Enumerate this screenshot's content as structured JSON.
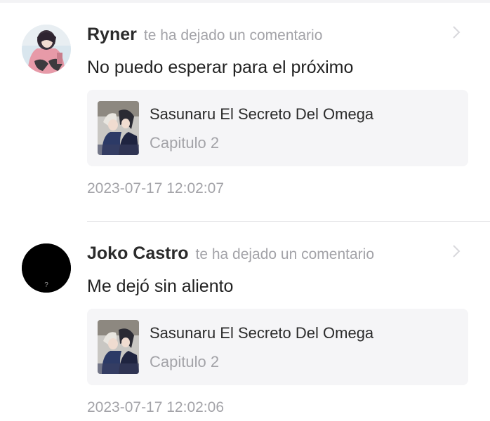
{
  "notifications": [
    {
      "username": "Ryner",
      "action": "te ha dejado un comentario",
      "comment": "No puedo esperar para el próximo",
      "avatar_icon": "anime-girl-avatar",
      "work": {
        "title": "Sasunaru El Secreto Del Omega",
        "chapter": "Capitulo 2"
      },
      "timestamp": "2023-07-17 12:02:07"
    },
    {
      "username": "Joko Castro",
      "action": "te ha dejado un comentario",
      "comment": "Me dejó sin aliento",
      "avatar_icon": "default-black-avatar",
      "avatar_glyph": "?",
      "work": {
        "title": "Sasunaru El Secreto Del Omega",
        "chapter": "Capitulo 2"
      },
      "timestamp": "2023-07-17 12:02:06"
    }
  ],
  "colors": {
    "text_primary": "#222222",
    "text_secondary": "#a3a3a8",
    "card_background": "#f5f5f7",
    "divider": "#e6e6e8"
  }
}
